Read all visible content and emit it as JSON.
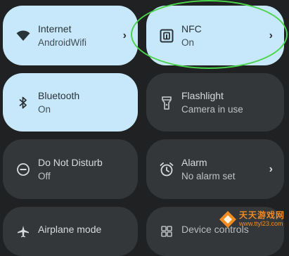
{
  "tiles": {
    "internet": {
      "label": "Internet",
      "sub": "AndroidWifi",
      "chevron": "›",
      "state": "on",
      "icon": "wifi-icon"
    },
    "nfc": {
      "label": "NFC",
      "sub": "On",
      "chevron": "›",
      "state": "on",
      "icon": "nfc-icon"
    },
    "bluetooth": {
      "label": "Bluetooth",
      "sub": "On",
      "state": "on",
      "icon": "bluetooth-icon"
    },
    "flashlight": {
      "label": "Flashlight",
      "sub": "Camera in use",
      "state": "off",
      "icon": "flashlight-icon"
    },
    "dnd": {
      "label": "Do Not Disturb",
      "sub": "Off",
      "state": "off",
      "icon": "do-not-disturb-icon"
    },
    "alarm": {
      "label": "Alarm",
      "sub": "No alarm set",
      "chevron": "›",
      "state": "off",
      "icon": "alarm-icon"
    },
    "airplane": {
      "label": "Airplane mode",
      "state": "off",
      "icon": "airplane-icon"
    },
    "device_controls": {
      "label": "Device controls",
      "state": "off",
      "icon": "device-controls-icon"
    }
  },
  "watermark": {
    "title": "天天游戏网",
    "url": "www.ttyl23.com"
  },
  "colors": {
    "tile_on": "#c7e8fb",
    "tile_off": "#343739",
    "background": "#1f2123",
    "highlight": "#49d449"
  }
}
